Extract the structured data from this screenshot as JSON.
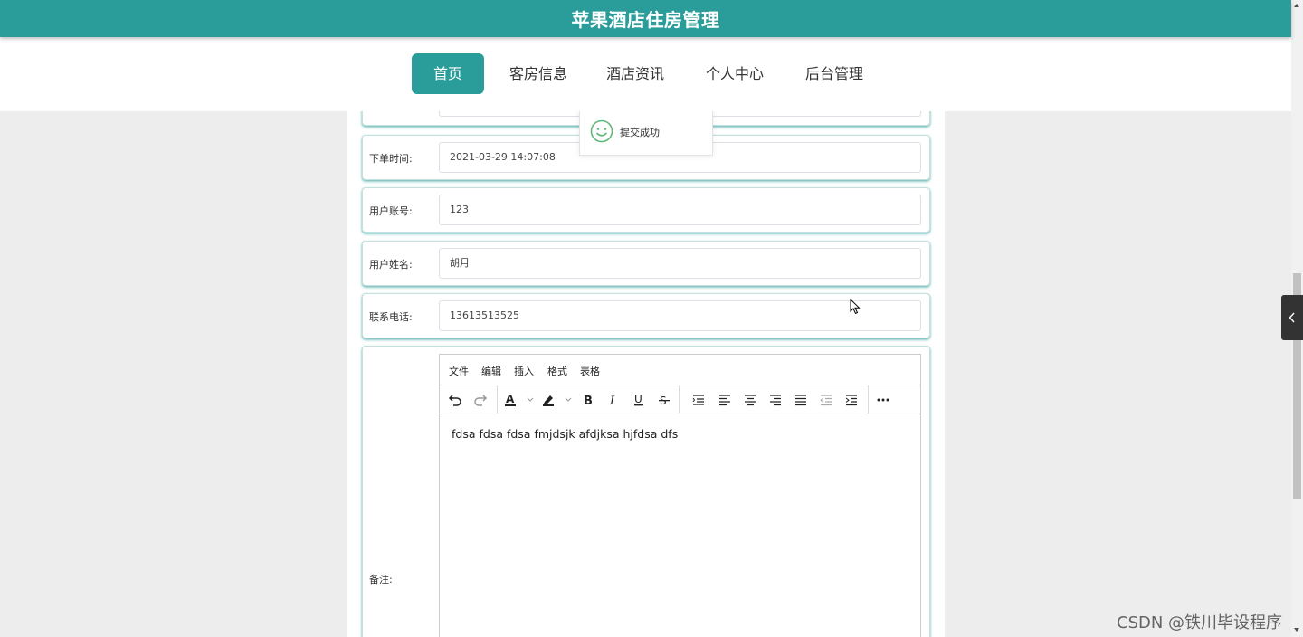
{
  "header": {
    "title": "苹果酒店住房管理",
    "bg_color": "#2a9d9b"
  },
  "nav": {
    "items": [
      {
        "label": "首页",
        "active": true
      },
      {
        "label": "客房信息"
      },
      {
        "label": "酒店资讯"
      },
      {
        "label": "个人中心"
      },
      {
        "label": "后台管理"
      }
    ]
  },
  "form": {
    "fields": [
      {
        "label": "",
        "value": ""
      },
      {
        "label": "下单时间:",
        "value": "2021-03-29 14:07:08"
      },
      {
        "label": "用户账号:",
        "value": "123"
      },
      {
        "label": "用户姓名:",
        "value": "胡月"
      },
      {
        "label": "联系电话:",
        "value": "13613513525"
      }
    ],
    "remark": {
      "label": "备注:",
      "editor": {
        "menus": [
          "文件",
          "编辑",
          "插入",
          "格式",
          "表格"
        ],
        "toolbar_icons": [
          "undo-icon",
          "redo-icon",
          "text-color-icon",
          "highlight-icon",
          "bold-icon",
          "italic-icon",
          "underline-icon",
          "strikethrough-icon",
          "line-height-icon",
          "align-left-icon",
          "align-center-icon",
          "align-right-icon",
          "align-justify-icon",
          "outdent-icon",
          "indent-icon",
          "more-icon"
        ],
        "content": "fdsa fdsa fdsa fmjdsjk afdjksa hjfdsa dfs"
      }
    }
  },
  "toast": {
    "message": "提交成功"
  },
  "watermark": "CSDN @铁川毕设程序"
}
